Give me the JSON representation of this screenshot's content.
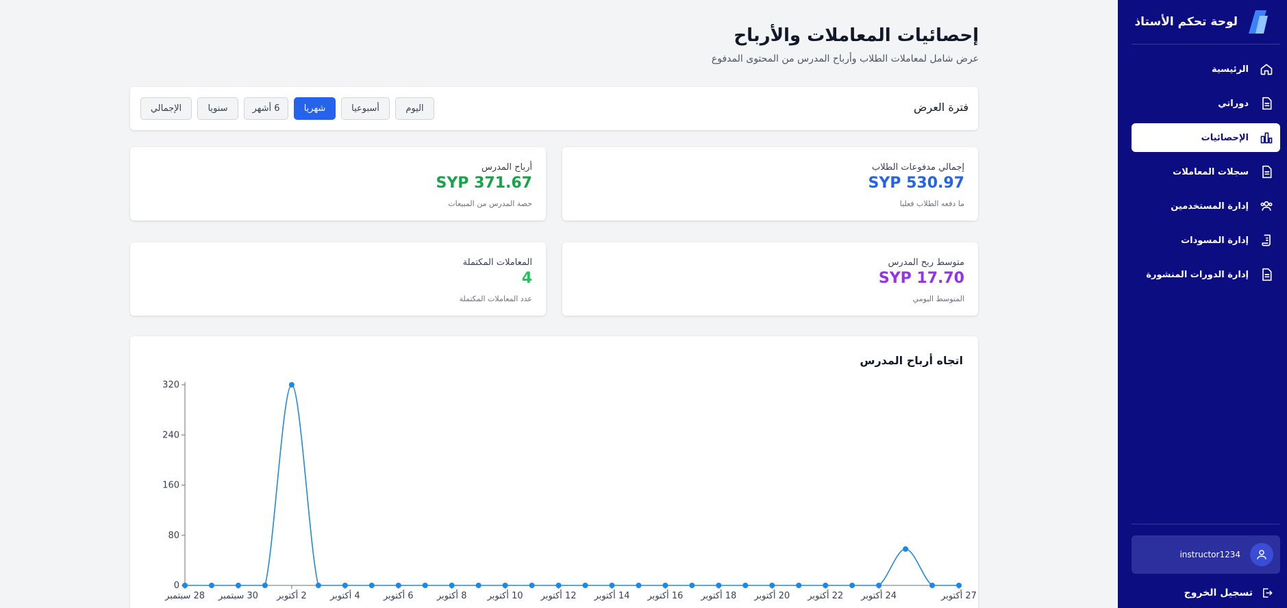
{
  "sidebar": {
    "brand_title": "لوحة تحكم الأستاذ",
    "items": [
      {
        "label": "الرئيسية",
        "icon": "home-icon",
        "active": false
      },
      {
        "label": "دوراتي",
        "icon": "document-icon",
        "active": false
      },
      {
        "label": "الإحصائيات",
        "icon": "bar-chart-icon",
        "active": true
      },
      {
        "label": "سجلات المعاملات",
        "icon": "document-icon",
        "active": false
      },
      {
        "label": "إدارة المستخدمين",
        "icon": "users-icon",
        "active": false
      },
      {
        "label": "إدارة المسودات",
        "icon": "scroll-icon",
        "active": false
      },
      {
        "label": "إدارة الدورات المنشورة",
        "icon": "document-icon",
        "active": false
      }
    ],
    "user_name": "instructor1234",
    "logout_label": "تسجيل الخروج"
  },
  "header": {
    "title": "إحصائيات المعاملات والأرباح",
    "subtitle": "عرض شامل لمعاملات الطلاب وأرباح المدرس من المحتوى المدفوع"
  },
  "period": {
    "label": "فترة العرض",
    "buttons": [
      "اليوم",
      "أسبوعيا",
      "شهريا",
      "6 أشهر",
      "سنويا",
      "الإجمالي"
    ],
    "active_index": 2
  },
  "stats": {
    "total_payments": {
      "label": "إجمالي مدفوعات الطلاب",
      "value": "SYP 530.97",
      "note": "ما دفعه الطلاب فعليا",
      "color": "#2563eb"
    },
    "instructor_earnings": {
      "label": "أرباح المدرس",
      "value": "SYP 371.67",
      "note": "حصة المدرس من المبيعات",
      "color": "#16a34a"
    },
    "avg_earnings": {
      "label": "متوسط ربح المدرس",
      "value": "SYP 17.70",
      "note": "المتوسط اليومي",
      "color": "#9333ea"
    },
    "completed_transactions": {
      "label": "المعاملات المكتملة",
      "value": "4",
      "note": "عدد المعاملات المكتملة",
      "color": "#22c55e"
    }
  },
  "chart_data": {
    "type": "line",
    "title": "اتجاه أرباح المدرس",
    "x": [
      "28 سبتمبر",
      "29 سبتمبر",
      "30 سبتمبر",
      "1 أكتوبر",
      "2 أكتوبر",
      "3 أكتوبر",
      "4 أكتوبر",
      "5 أكتوبر",
      "6 أكتوبر",
      "7 أكتوبر",
      "8 أكتوبر",
      "9 أكتوبر",
      "10 أكتوبر",
      "11 أكتوبر",
      "12 أكتوبر",
      "13 أكتوبر",
      "14 أكتوبر",
      "15 أكتوبر",
      "16 أكتوبر",
      "17 أكتوبر",
      "18 أكتوبر",
      "19 أكتوبر",
      "20 أكتوبر",
      "21 أكتوبر",
      "22 أكتوبر",
      "23 أكتوبر",
      "24 أكتوبر",
      "25 أكتوبر",
      "26 أكتوبر",
      "27 أكتوبر"
    ],
    "x_tick_labels": [
      "28 سبتمبر",
      "30 سبتمبر",
      "2 أكتوبر",
      "4 أكتوبر",
      "6 أكتوبر",
      "8 أكتوبر",
      "10 أكتوبر",
      "12 أكتوبر",
      "14 أكتوبر",
      "16 أكتوبر",
      "18 أكتوبر",
      "20 أكتوبر",
      "22 أكتوبر",
      "24 أكتوبر",
      "27 أكتوبر"
    ],
    "x_tick_indices": [
      0,
      2,
      4,
      6,
      8,
      10,
      12,
      14,
      16,
      18,
      20,
      22,
      24,
      26,
      29
    ],
    "series": [
      {
        "values": [
          0,
          0,
          0,
          0,
          320,
          0,
          0,
          0,
          0,
          0,
          0,
          0,
          0,
          0,
          0,
          0,
          0,
          0,
          0,
          0,
          0,
          0,
          0,
          0,
          0,
          0,
          0,
          58,
          0,
          0
        ],
        "color": "#1e88e5"
      }
    ],
    "ylim": [
      0,
      320
    ],
    "yticks": [
      0,
      80,
      160,
      240,
      320
    ],
    "grid": false,
    "legend": "none"
  },
  "colors": {
    "sidebar_bg": "#0b0d80",
    "accent": "#2563eb"
  }
}
